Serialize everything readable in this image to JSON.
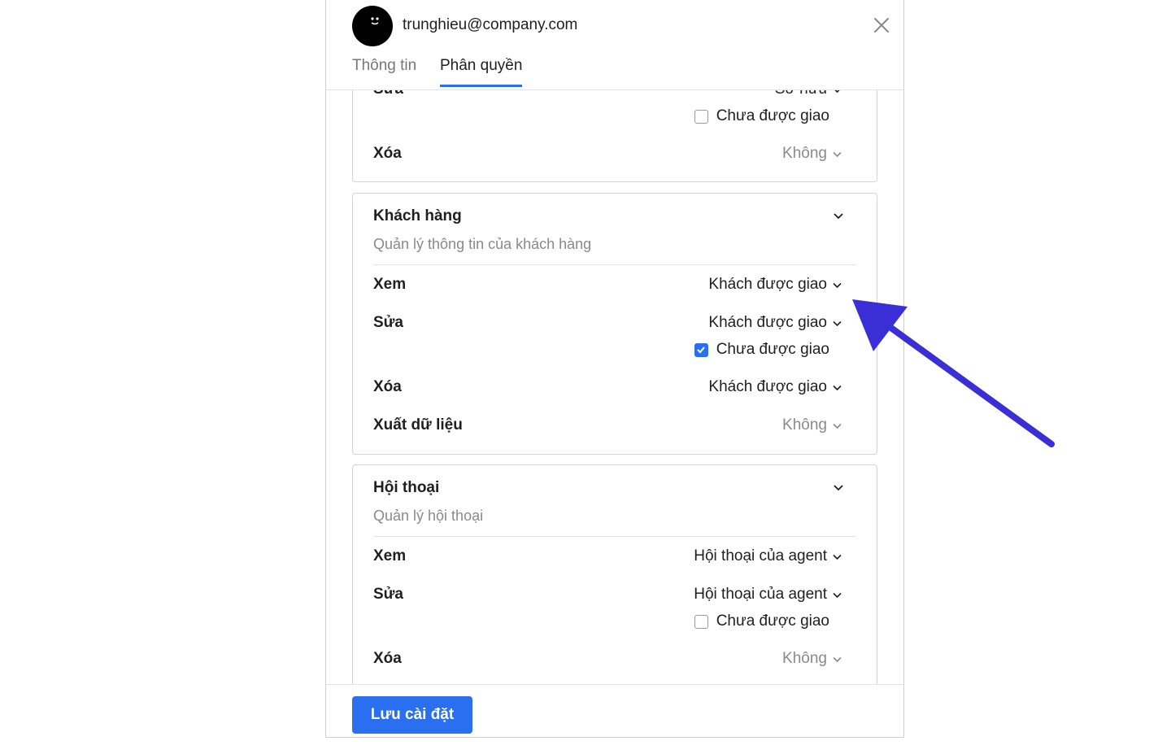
{
  "header": {
    "email": "trunghieu@company.com",
    "tabs": [
      {
        "label": "Thông tin",
        "active": false
      },
      {
        "label": "Phân quyền",
        "active": true
      }
    ]
  },
  "card_top": {
    "rows": [
      {
        "label": "Sửa",
        "value": "Sở hữu"
      },
      {
        "label": "Xóa",
        "value": "Không"
      }
    ],
    "checkbox": {
      "label": "Chưa được giao",
      "checked": false
    }
  },
  "card_customers": {
    "title": "Khách hàng",
    "subtitle": "Quản lý thông tin của khách hàng",
    "rows": [
      {
        "label": "Xem",
        "value": "Khách được giao"
      },
      {
        "label": "Sửa",
        "value": "Khách được giao"
      },
      {
        "label": "Xóa",
        "value": "Khách được giao"
      },
      {
        "label": "Xuất dữ liệu",
        "value": "Không"
      }
    ],
    "checkbox": {
      "label": "Chưa được giao",
      "checked": true
    }
  },
  "card_conversations": {
    "title": "Hội thoại",
    "subtitle": "Quản lý hội thoại",
    "rows": [
      {
        "label": "Xem",
        "value": "Hội thoại của agent"
      },
      {
        "label": "Sửa",
        "value": "Hội thoại của agent"
      },
      {
        "label": "Xóa",
        "value": "Không"
      }
    ],
    "checkbox": {
      "label": "Chưa được giao",
      "checked": false
    }
  },
  "footer": {
    "save_label": "Lưu cài đặt"
  },
  "colors": {
    "accent": "#2a6ff0",
    "annotation_arrow": "#3a2fd6"
  }
}
